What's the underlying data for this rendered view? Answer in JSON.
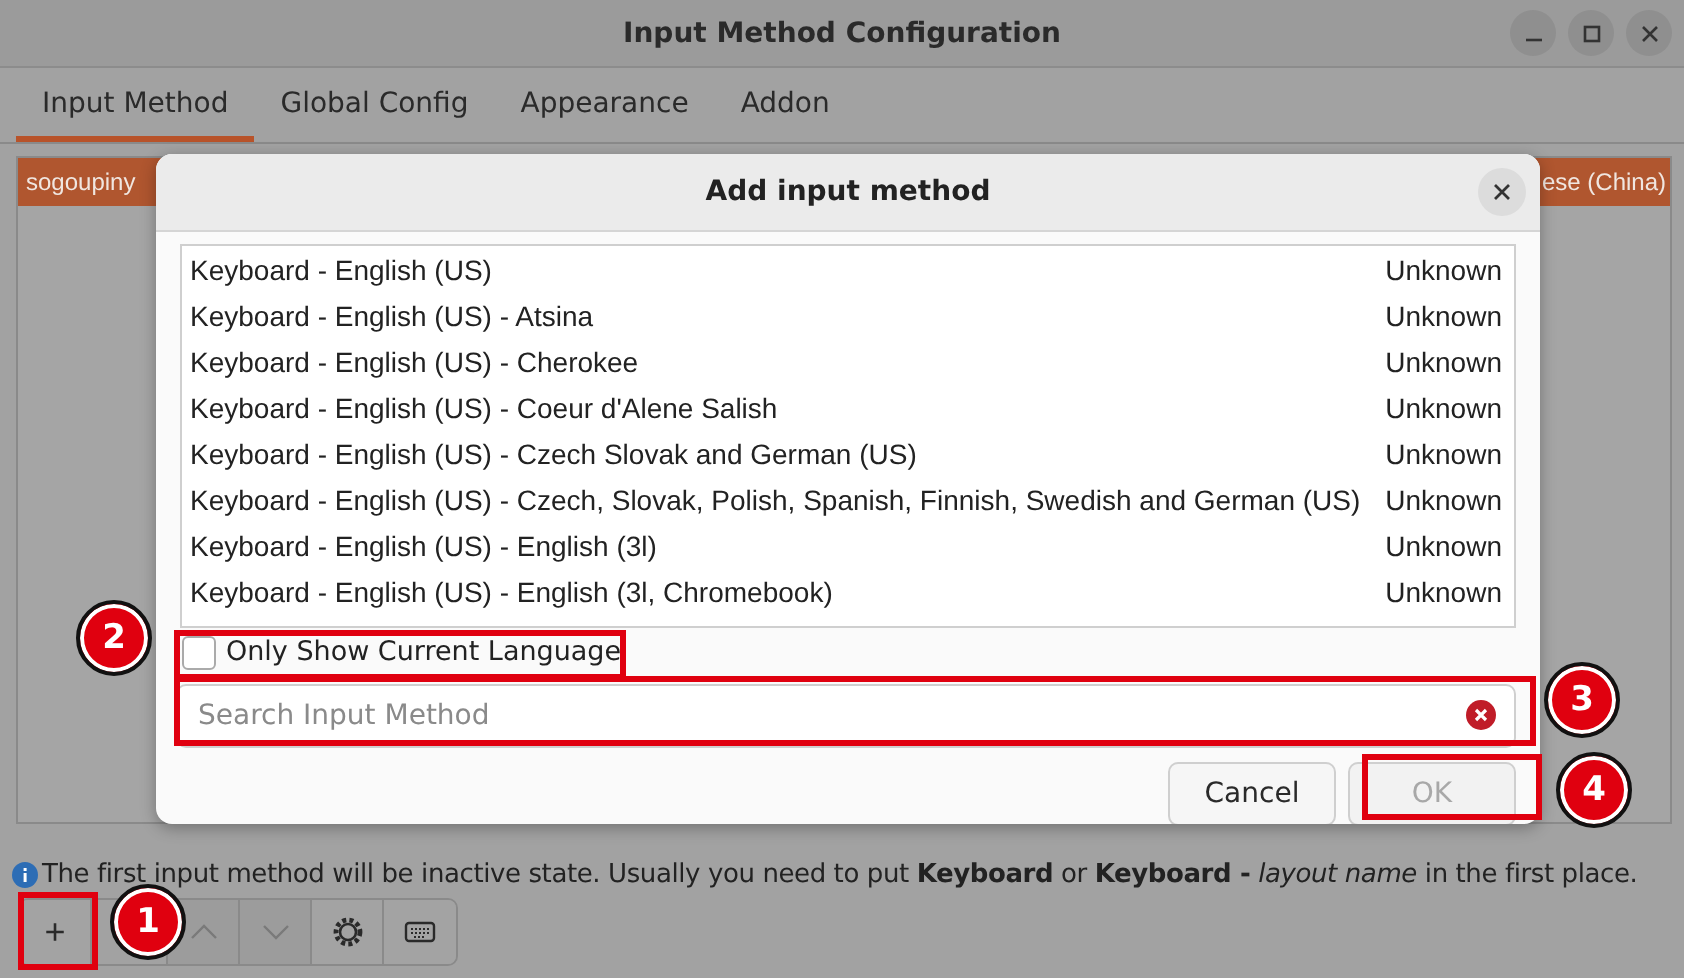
{
  "window": {
    "title": "Input Method Configuration"
  },
  "tabs": [
    {
      "label": "Input Method",
      "selected": true
    },
    {
      "label": "Global Config",
      "selected": false
    },
    {
      "label": "Appearance",
      "selected": false
    },
    {
      "label": "Addon",
      "selected": false
    }
  ],
  "current_list": {
    "rows": [
      {
        "name": "sogoupiny",
        "language": "ese (China)",
        "selected": true
      }
    ]
  },
  "dialog": {
    "title": "Add input method",
    "methods": [
      {
        "name": "Keyboard - English (US)",
        "language": "Unknown"
      },
      {
        "name": "Keyboard - English (US) - Atsina",
        "language": "Unknown"
      },
      {
        "name": "Keyboard - English (US) - Cherokee",
        "language": "Unknown"
      },
      {
        "name": "Keyboard - English (US) - Coeur d'Alene Salish",
        "language": "Unknown"
      },
      {
        "name": "Keyboard - English (US) - Czech Slovak and German (US)",
        "language": "Unknown"
      },
      {
        "name": "Keyboard - English (US) - Czech, Slovak, Polish, Spanish, Finnish, Swedish and German (US)",
        "language": "Unknown"
      },
      {
        "name": "Keyboard - English (US) - English (3l)",
        "language": "Unknown"
      },
      {
        "name": "Keyboard - English (US) - English (3l, Chromebook)",
        "language": "Unknown"
      }
    ],
    "only_current_language": {
      "label": "Only Show Current Language",
      "checked": false
    },
    "search": {
      "placeholder": "Search Input Method"
    },
    "buttons": [
      {
        "label": "Cancel",
        "disabled": false
      },
      {
        "label": "OK",
        "disabled": true
      }
    ]
  },
  "info": "The first input method will be inactive state. Usually you need to put **Keyboard** or **Keyboard -** *layout name* in the first place.",
  "toolbar": [
    {
      "kind": "add",
      "label": "+",
      "disabled": false
    },
    {
      "kind": "up",
      "disabled": true
    },
    {
      "kind": "down",
      "disabled": true
    },
    {
      "kind": "configure",
      "disabled": false
    },
    {
      "kind": "keyboard",
      "disabled": false
    }
  ],
  "annotations": [
    {
      "number": "1"
    },
    {
      "number": "2"
    },
    {
      "number": "3"
    },
    {
      "number": "4"
    }
  ]
}
